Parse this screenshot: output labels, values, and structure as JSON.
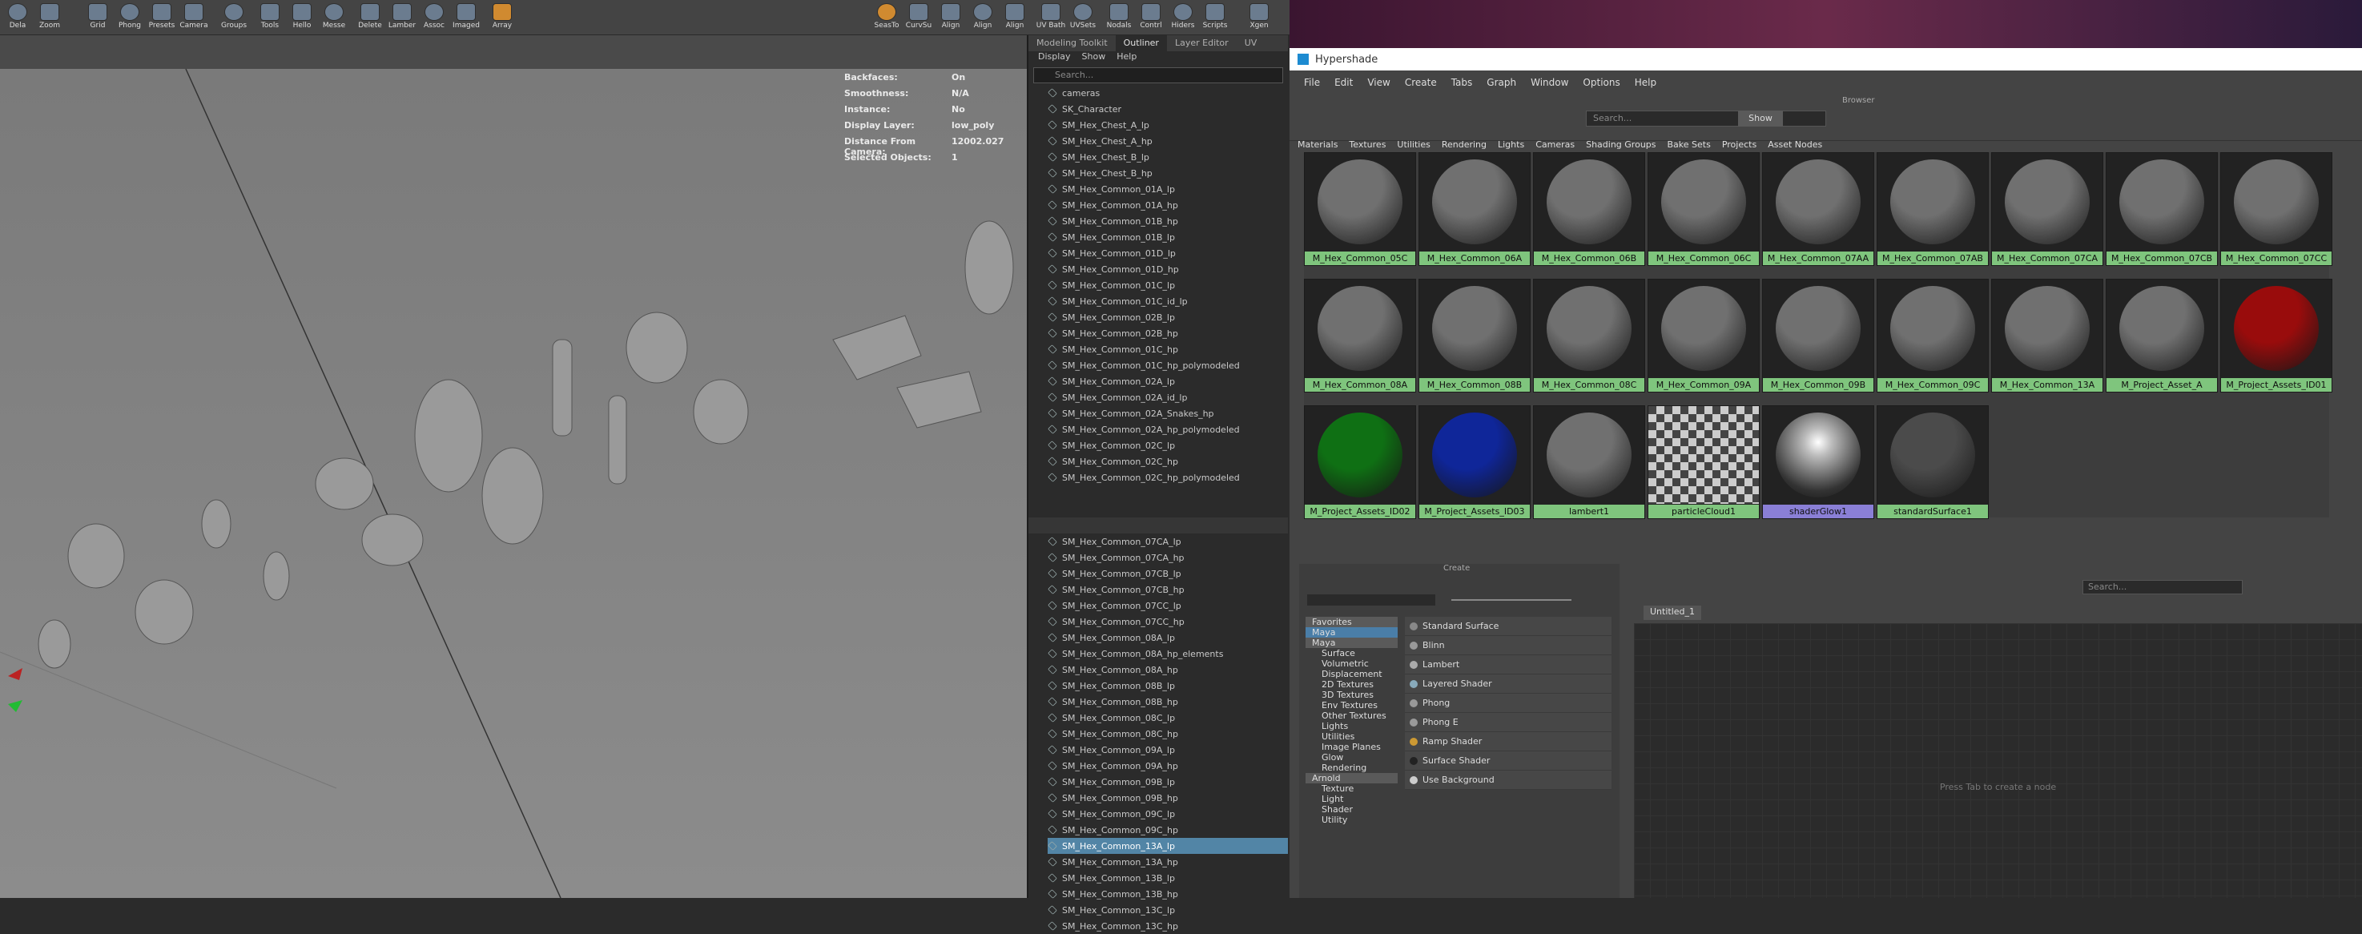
{
  "shelf": {
    "labels": [
      "Dela",
      "Zoom",
      "Grid",
      "Phong",
      "Presets",
      "Camera",
      "Groups",
      "Tools",
      "Hello",
      "Messe",
      "Delete",
      "Lamber",
      "Assoc",
      "Imaged",
      "Array",
      "SeasTo",
      "CurvSu",
      "Align",
      "Align",
      "Align",
      "UV Bath",
      "UVSets",
      "Nodals",
      "Contrl",
      "Hiders",
      "Scripts",
      "Xgen"
    ]
  },
  "hud": {
    "rows": [
      [
        "Backfaces:",
        "On"
      ],
      [
        "Smoothness:",
        "N/A"
      ],
      [
        "Instance:",
        "No"
      ],
      [
        "Display Layer:",
        "low_poly"
      ],
      [
        "Distance From Camera:",
        "12002.027"
      ],
      [
        "Selected Objects:",
        "1"
      ]
    ]
  },
  "outliner": {
    "tabs": [
      "Modeling Toolkit",
      "Outliner",
      "Layer Editor",
      "UV"
    ],
    "menu": [
      "Display",
      "Show",
      "Help"
    ],
    "search_placeholder": "Search...",
    "items_top": [
      "cameras",
      "SK_Character",
      "SM_Hex_Chest_A_lp",
      "SM_Hex_Chest_A_hp",
      "SM_Hex_Chest_B_lp",
      "SM_Hex_Chest_B_hp",
      "SM_Hex_Common_01A_lp",
      "SM_Hex_Common_01A_hp",
      "SM_Hex_Common_01B_hp",
      "SM_Hex_Common_01B_lp",
      "SM_Hex_Common_01D_lp",
      "SM_Hex_Common_01D_hp",
      "SM_Hex_Common_01C_lp",
      "SM_Hex_Common_01C_id_lp",
      "SM_Hex_Common_02B_lp",
      "SM_Hex_Common_02B_hp",
      "SM_Hex_Common_01C_hp",
      "SM_Hex_Common_01C_hp_polymodeled",
      "SM_Hex_Common_02A_lp",
      "SM_Hex_Common_02A_id_lp",
      "SM_Hex_Common_02A_Snakes_hp",
      "SM_Hex_Common_02A_hp_polymodeled",
      "SM_Hex_Common_02C_lp",
      "SM_Hex_Common_02C_hp",
      "SM_Hex_Common_02C_hp_polymodeled"
    ],
    "items_bottom": [
      "SM_Hex_Common_07CA_lp",
      "SM_Hex_Common_07CA_hp",
      "SM_Hex_Common_07CB_lp",
      "SM_Hex_Common_07CB_hp",
      "SM_Hex_Common_07CC_lp",
      "SM_Hex_Common_07CC_hp",
      "SM_Hex_Common_08A_lp",
      "SM_Hex_Common_08A_hp_elements",
      "SM_Hex_Common_08A_hp",
      "SM_Hex_Common_08B_lp",
      "SM_Hex_Common_08B_hp",
      "SM_Hex_Common_08C_lp",
      "SM_Hex_Common_08C_hp",
      "SM_Hex_Common_09A_lp",
      "SM_Hex_Common_09A_hp",
      "SM_Hex_Common_09B_lp",
      "SM_Hex_Common_09B_hp",
      "SM_Hex_Common_09C_lp",
      "SM_Hex_Common_09C_hp",
      "SM_Hex_Common_13A_lp",
      "SM_Hex_Common_13A_hp",
      "SM_Hex_Common_13B_lp",
      "SM_Hex_Common_13B_hp",
      "SM_Hex_Common_13C_lp",
      "SM_Hex_Common_13C_hp"
    ],
    "selected": "SM_Hex_Common_13A_lp"
  },
  "hypershade": {
    "title": "Hypershade",
    "menu": [
      "File",
      "Edit",
      "View",
      "Create",
      "Tabs",
      "Graph",
      "Window",
      "Options",
      "Help"
    ],
    "browser_label": "Browser",
    "search_placeholder": "Search...",
    "show_label": "Show",
    "tabs": [
      "Materials",
      "Textures",
      "Utilities",
      "Rendering",
      "Lights",
      "Cameras",
      "Shading Groups",
      "Bake Sets",
      "Projects",
      "Asset Nodes"
    ],
    "materials": [
      {
        "name": "M_Hex_Common_05C",
        "color": "#5a5a5a"
      },
      {
        "name": "M_Hex_Common_06A",
        "color": "#5a5a5a"
      },
      {
        "name": "M_Hex_Common_06B",
        "color": "#5a5a5a"
      },
      {
        "name": "M_Hex_Common_06C",
        "color": "#5a5a5a"
      },
      {
        "name": "M_Hex_Common_07AA",
        "color": "#5a5a5a"
      },
      {
        "name": "M_Hex_Common_07AB",
        "color": "#5a5a5a"
      },
      {
        "name": "M_Hex_Common_07CA",
        "color": "#5a5a5a"
      },
      {
        "name": "M_Hex_Common_07CB",
        "color": "#5a5a5a"
      },
      {
        "name": "M_Hex_Common_07CC",
        "color": "#5a5a5a"
      },
      {
        "name": "M_Hex_Common_08A",
        "color": "#5a5a5a"
      },
      {
        "name": "M_Hex_Common_08B",
        "color": "#5a5a5a"
      },
      {
        "name": "M_Hex_Common_08C",
        "color": "#5a5a5a"
      },
      {
        "name": "M_Hex_Common_09A",
        "color": "#5a5a5a"
      },
      {
        "name": "M_Hex_Common_09B",
        "color": "#5a5a5a"
      },
      {
        "name": "M_Hex_Common_09C",
        "color": "#5a5a5a"
      },
      {
        "name": "M_Hex_Common_13A",
        "color": "#5a5a5a"
      },
      {
        "name": "M_Project_Asset_A",
        "color": "#5a5a5a"
      },
      {
        "name": "M_Project_Assets_ID01",
        "color": "#7a0a0a"
      },
      {
        "name": "M_Project_Assets_ID02",
        "color": "#0c5a10"
      },
      {
        "name": "M_Project_Assets_ID03",
        "color": "#0c1e7a"
      },
      {
        "name": "lambert1",
        "color": "#5a5a5a"
      },
      {
        "name": "particleCloud1",
        "color": "checker"
      },
      {
        "name": "shaderGlow1",
        "color": "glow"
      },
      {
        "name": "standardSurface1",
        "color": "#3c3c3c"
      }
    ],
    "create_label": "Create",
    "create_tree": [
      "Favorites",
      "Maya",
      "Maya",
      "Surface",
      "Volumetric",
      "Displacement",
      "2D Textures",
      "3D Textures",
      "Env Textures",
      "Other Textures",
      "Lights",
      "Utilities",
      "Image Planes",
      "Glow",
      "Rendering",
      "Arnold",
      "Texture",
      "Light",
      "Shader",
      "Utility"
    ],
    "create_items": [
      "Standard Surface",
      "Blinn",
      "Lambert",
      "Layered Shader",
      "Phong",
      "Phong E",
      "Ramp Shader",
      "Surface Shader",
      "Use Background"
    ],
    "node_search": "Search...",
    "node_tab": "Untitled_1",
    "node_hint": "Press Tab to create a node"
  }
}
